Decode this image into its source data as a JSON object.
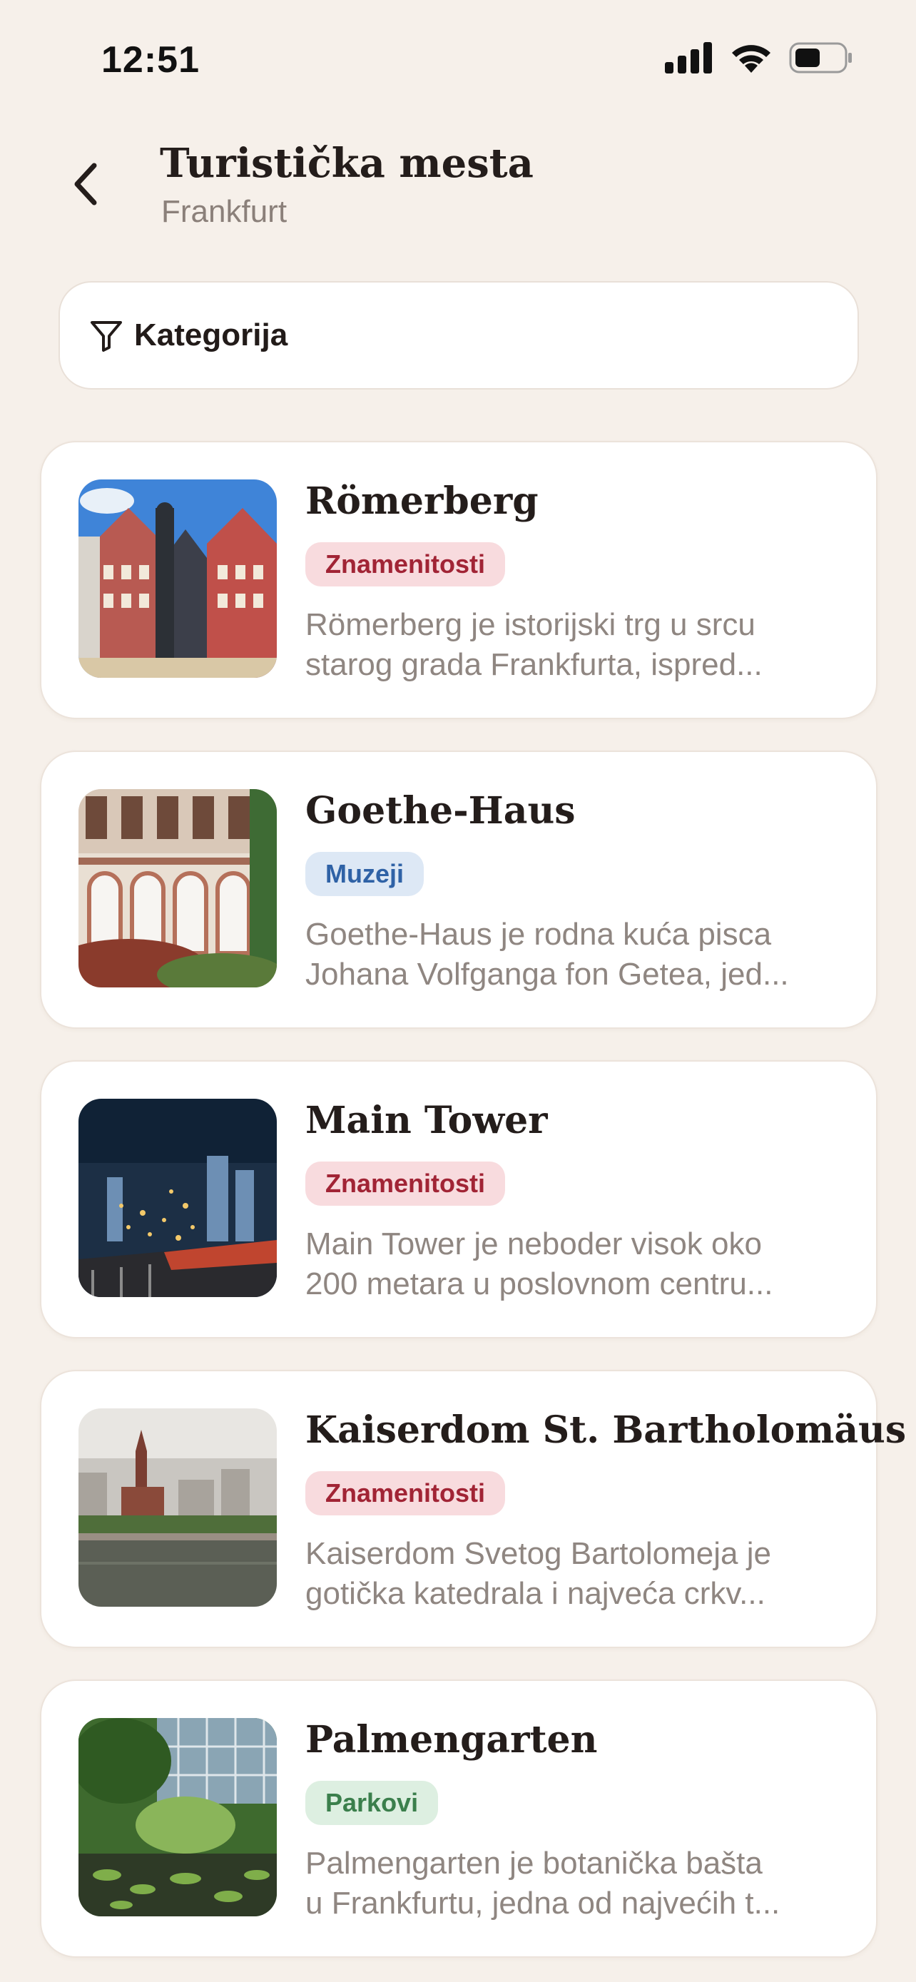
{
  "status_bar": {
    "time": "12:51"
  },
  "header": {
    "title": "Turistička mesta",
    "subtitle": "Frankfurt"
  },
  "filter": {
    "label": "Kategorija"
  },
  "places": [
    {
      "title": "Römerberg",
      "category": "Znamenitosti",
      "description": "Römerberg je istorijski trg u srcu\nstarog grada Frankfurta, ispred..."
    },
    {
      "title": "Goethe-Haus",
      "category": "Muzeji",
      "description": "Goethe-Haus je rodna kuća pisca\nJohana Volfganga fon Getea, jed..."
    },
    {
      "title": "Main Tower",
      "category": "Znamenitosti",
      "description": "Main Tower je neboder visok oko\n200 metara u poslovnom centru..."
    },
    {
      "title": "Kaiserdom St. Bartholomäus",
      "category": "Znamenitosti",
      "description": "Kaiserdom Svetog Bartolomeja je\ngotička katedrala i najveća crkv..."
    },
    {
      "title": "Palmengarten",
      "category": "Parkovi",
      "description": "Palmengarten je botanička bašta\nu Frankfurtu, jedna od najvećih t..."
    }
  ],
  "colors": {
    "background": "#f6f0ea",
    "badge_landmarks": "#a12435",
    "badge_museums": "#2f62a6",
    "badge_parks": "#3b7f4c"
  },
  "icons": {
    "back": "chevron-left-icon",
    "filter": "filter-funnel-icon",
    "signal": "cellular-signal-icon",
    "wifi": "wifi-icon",
    "battery": "battery-icon"
  }
}
